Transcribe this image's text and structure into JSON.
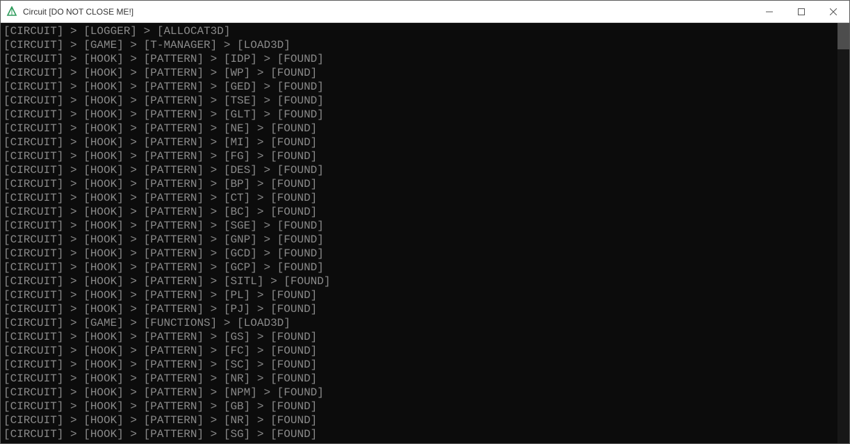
{
  "window": {
    "title": "Circuit [DO NOT CLOSE ME!]"
  },
  "console": {
    "lines": [
      "[CIRCUIT] > [LOGGER] > [ALLOCAT3D]",
      "[CIRCUIT] > [GAME] > [T-MANAGER] > [LOAD3D]",
      "[CIRCUIT] > [HOOK] > [PATTERN] > [IDP] > [FOUND]",
      "[CIRCUIT] > [HOOK] > [PATTERN] > [WP] > [FOUND]",
      "[CIRCUIT] > [HOOK] > [PATTERN] > [GED] > [FOUND]",
      "[CIRCUIT] > [HOOK] > [PATTERN] > [TSE] > [FOUND]",
      "[CIRCUIT] > [HOOK] > [PATTERN] > [GLT] > [FOUND]",
      "[CIRCUIT] > [HOOK] > [PATTERN] > [NE] > [FOUND]",
      "[CIRCUIT] > [HOOK] > [PATTERN] > [MI] > [FOUND]",
      "[CIRCUIT] > [HOOK] > [PATTERN] > [FG] > [FOUND]",
      "[CIRCUIT] > [HOOK] > [PATTERN] > [DES] > [FOUND]",
      "[CIRCUIT] > [HOOK] > [PATTERN] > [BP] > [FOUND]",
      "[CIRCUIT] > [HOOK] > [PATTERN] > [CT] > [FOUND]",
      "[CIRCUIT] > [HOOK] > [PATTERN] > [BC] > [FOUND]",
      "[CIRCUIT] > [HOOK] > [PATTERN] > [SGE] > [FOUND]",
      "[CIRCUIT] > [HOOK] > [PATTERN] > [GNP] > [FOUND]",
      "[CIRCUIT] > [HOOK] > [PATTERN] > [GCD] > [FOUND]",
      "[CIRCUIT] > [HOOK] > [PATTERN] > [GCP] > [FOUND]",
      "[CIRCUIT] > [HOOK] > [PATTERN] > [SITL] > [FOUND]",
      "[CIRCUIT] > [HOOK] > [PATTERN] > [PL] > [FOUND]",
      "[CIRCUIT] > [HOOK] > [PATTERN] > [PJ] > [FOUND]",
      "[CIRCUIT] > [GAME] > [FUNCTIONS] > [LOAD3D]",
      "[CIRCUIT] > [HOOK] > [PATTERN] > [GS] > [FOUND]",
      "[CIRCUIT] > [HOOK] > [PATTERN] > [FC] > [FOUND]",
      "[CIRCUIT] > [HOOK] > [PATTERN] > [SC] > [FOUND]",
      "[CIRCUIT] > [HOOK] > [PATTERN] > [NR] > [FOUND]",
      "[CIRCUIT] > [HOOK] > [PATTERN] > [NPM] > [FOUND]",
      "[CIRCUIT] > [HOOK] > [PATTERN] > [GB] > [FOUND]",
      "[CIRCUIT] > [HOOK] > [PATTERN] > [NR] > [FOUND]",
      "[CIRCUIT] > [HOOK] > [PATTERN] > [SG] > [FOUND]"
    ]
  }
}
